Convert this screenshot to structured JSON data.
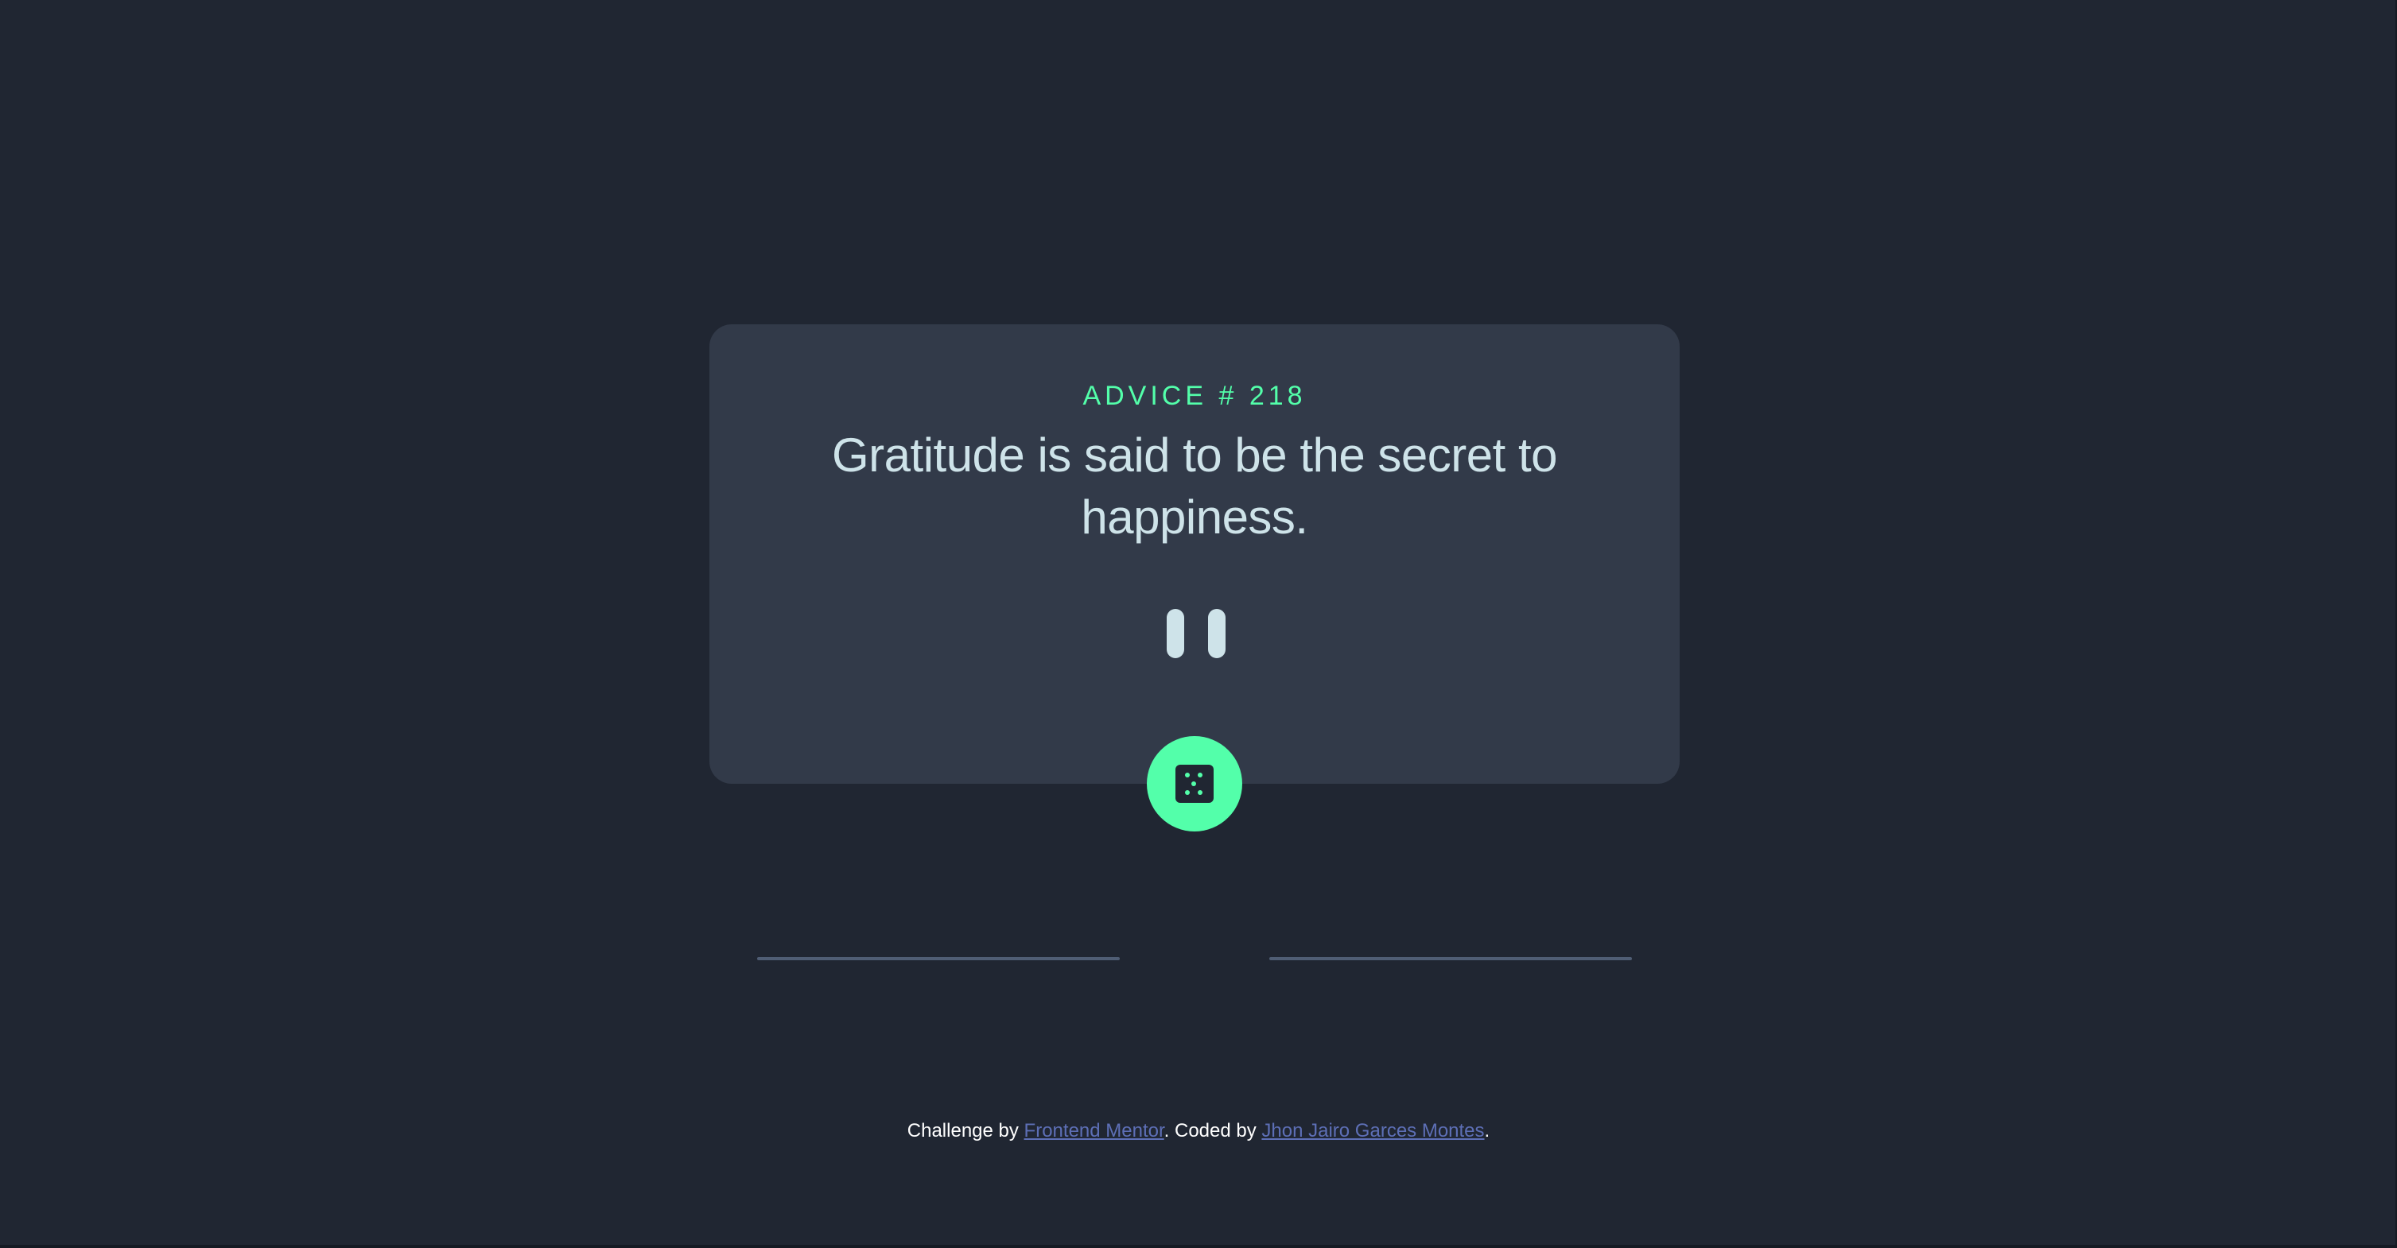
{
  "card": {
    "advice_label": "ADVICE # 218",
    "quote": "Gratitude is said to be the secret to happiness."
  },
  "footer": {
    "prefix": "Challenge by ",
    "mentor_link": "Frontend Mentor",
    "middle": ". Coded by ",
    "author_link": "Jhon Jairo Garces Montes",
    "suffix": "."
  },
  "colors": {
    "background": "#202632",
    "card": "#323a49",
    "accent": "#53ffaa",
    "quote_text": "#cee3e9",
    "divider": "#4f5d74",
    "link": "#5d6fb6"
  },
  "icons": {
    "divider": "pause-icon",
    "button": "dice-icon"
  }
}
